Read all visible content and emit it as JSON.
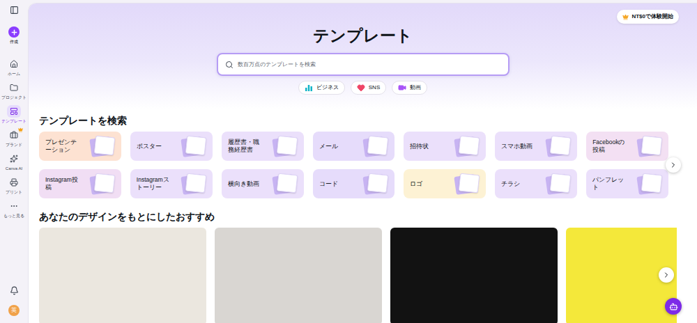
{
  "sidebar": {
    "create": {
      "label": "作成"
    },
    "items": [
      {
        "label": "ホーム",
        "selected": false,
        "premium": false
      },
      {
        "label": "プロジェクト",
        "selected": false,
        "premium": false
      },
      {
        "label": "テンプレート",
        "selected": true,
        "premium": false
      },
      {
        "label": "ブランド",
        "selected": false,
        "premium": true
      },
      {
        "label": "Canva AI",
        "selected": false,
        "premium": false
      },
      {
        "label": "プリント",
        "selected": false,
        "premium": false
      },
      {
        "label": "もっと見る",
        "selected": false,
        "premium": false
      }
    ],
    "avatar": "英"
  },
  "header": {
    "title": "テンプレート",
    "trial_button": "NT$0で体験開始",
    "search": {
      "placeholder": "数百万点のテンプレートを検索"
    },
    "chips": [
      "ビジネス",
      "SNS",
      "動画"
    ]
  },
  "categories": {
    "title": "テンプレートを検索",
    "items": [
      {
        "label": "プレゼンテーション",
        "color": "#fde2d2"
      },
      {
        "label": "ポスター",
        "color": "#ebe0fb"
      },
      {
        "label": "履歴書・職務経歴書",
        "color": "#ebe0fb"
      },
      {
        "label": "メール",
        "color": "#e6dcfb"
      },
      {
        "label": "招待状",
        "color": "#ebe0fb"
      },
      {
        "label": "スマホ動画",
        "color": "#ebe0fb"
      },
      {
        "label": "Facebookの投稿",
        "color": "#f3e0f3"
      },
      {
        "label": "Instagram投稿",
        "color": "#f1def4"
      },
      {
        "label": "Instagramストーリー",
        "color": "#ebe0fb"
      },
      {
        "label": "横向き動画",
        "color": "#ebe0fb"
      },
      {
        "label": "コード",
        "color": "#e6dcfb"
      },
      {
        "label": "ロゴ",
        "color": "#fdf2d4"
      },
      {
        "label": "チラシ",
        "color": "#ebe0fb"
      },
      {
        "label": "パンフレット",
        "color": "#ebe0fb"
      }
    ]
  },
  "recommendations": {
    "title": "あなたのデザインをもとにしたおすすめ",
    "cards": [
      {
        "color": "#ebe7df"
      },
      {
        "color": "#d9d6d2"
      },
      {
        "color": "#121212"
      },
      {
        "color": "#f4e83a"
      }
    ]
  }
}
